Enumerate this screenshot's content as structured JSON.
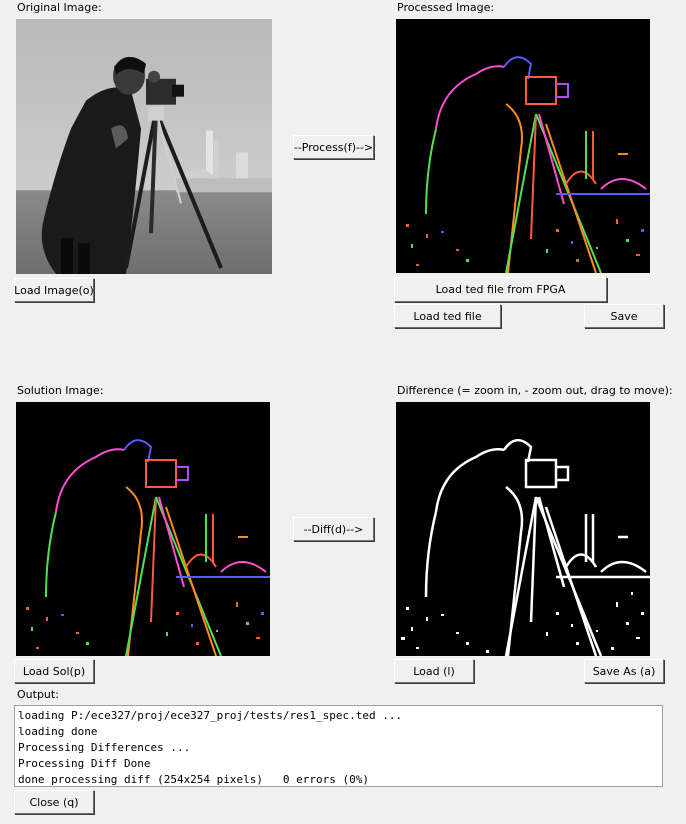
{
  "labels": {
    "original": "Original Image:",
    "processed": "Processed Image:",
    "solution": "Solution Image:",
    "difference": "Difference (= zoom in, - zoom out, drag to move):",
    "output": "Output:"
  },
  "buttons": {
    "load_image": "Load Image(o)",
    "process": "--Process(f)-->",
    "load_fpga": "Load ted file from FPGA",
    "load_ted": "Load ted file",
    "save": "Save",
    "load_sol": "Load Sol(p)",
    "diff": "--Diff(d)-->",
    "load": "Load (l)",
    "save_as": "Save As (a)",
    "close": "Close (q)"
  },
  "output_lines": [
    "loading P:/ece327/proj/ece327_proj/tests/res1_spec.ted ...",
    "loading done",
    "Processing Differences ...",
    "Processing Diff Done",
    "done processing diff (254x254 pixels)   0 errors (0%)"
  ],
  "colors": {
    "window_bg": "#f0f0f0",
    "edge_red": "#ff5a3c",
    "edge_green": "#52e052",
    "edge_pink": "#ff4fd0",
    "edge_blue": "#5a5aff",
    "edge_orange": "#ff8a1e",
    "edge_purple": "#b04cff"
  },
  "icons": {
    "original": "cameraman-grayscale-image",
    "processed": "cameraman-edge-color-image",
    "solution": "cameraman-edge-solution-image",
    "difference": "cameraman-edge-difference-image"
  }
}
